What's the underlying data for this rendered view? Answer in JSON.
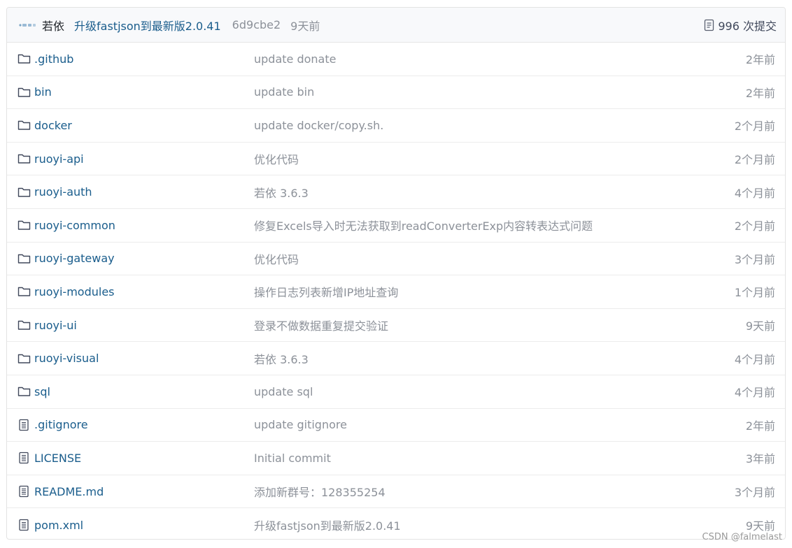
{
  "header": {
    "author": "若依",
    "commit_message": "升级fastjson到最新版2.0.41",
    "sha": "6d9cbe2",
    "time": "9天前",
    "commit_count": "996 次提交"
  },
  "files": [
    {
      "type": "folder",
      "name": ".github",
      "message": "update donate",
      "time": "2年前"
    },
    {
      "type": "folder",
      "name": "bin",
      "message": "update bin",
      "time": "2年前"
    },
    {
      "type": "folder",
      "name": "docker",
      "message": "update docker/copy.sh.",
      "time": "2个月前"
    },
    {
      "type": "folder",
      "name": "ruoyi-api",
      "message": "优化代码",
      "time": "2个月前"
    },
    {
      "type": "folder",
      "name": "ruoyi-auth",
      "message": "若依 3.6.3",
      "time": "4个月前"
    },
    {
      "type": "folder",
      "name": "ruoyi-common",
      "message": "修复Excels导入时无法获取到readConverterExp内容转表达式问题",
      "time": "2个月前"
    },
    {
      "type": "folder",
      "name": "ruoyi-gateway",
      "message": "优化代码",
      "time": "3个月前"
    },
    {
      "type": "folder",
      "name": "ruoyi-modules",
      "message": "操作日志列表新增IP地址查询",
      "time": "1个月前"
    },
    {
      "type": "folder",
      "name": "ruoyi-ui",
      "message": "登录不做数据重复提交验证",
      "time": "9天前"
    },
    {
      "type": "folder",
      "name": "ruoyi-visual",
      "message": "若依 3.6.3",
      "time": "4个月前"
    },
    {
      "type": "folder",
      "name": "sql",
      "message": "update sql",
      "time": "4个月前"
    },
    {
      "type": "file",
      "name": ".gitignore",
      "message": "update gitignore",
      "time": "2年前"
    },
    {
      "type": "file",
      "name": "LICENSE",
      "message": "Initial commit",
      "time": "3年前"
    },
    {
      "type": "file",
      "name": "README.md",
      "message": "添加新群号：128355254",
      "time": "3个月前"
    },
    {
      "type": "file",
      "name": "pom.xml",
      "message": "升级fastjson到最新版2.0.41",
      "time": "9天前"
    }
  ],
  "icons": {
    "folder": "folder-icon",
    "file": "file-icon",
    "commits": "commit-history-icon"
  },
  "watermark": "CSDN @falmelast"
}
